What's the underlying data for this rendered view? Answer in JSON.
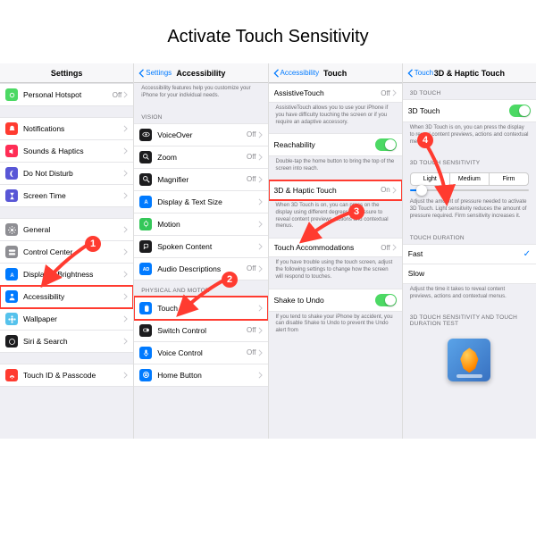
{
  "title": "Activate Touch Sensitivity",
  "panes": {
    "settings": {
      "header": "Settings",
      "groups": [
        [
          {
            "icon": "link",
            "bg": "#4cd964",
            "label": "Personal Hotspot",
            "val": "Off"
          }
        ],
        [
          {
            "icon": "bell",
            "bg": "#ff3b30",
            "label": "Notifications"
          },
          {
            "icon": "sound",
            "bg": "#ff2d55",
            "label": "Sounds & Haptics"
          },
          {
            "icon": "moon",
            "bg": "#5856d6",
            "label": "Do Not Disturb"
          },
          {
            "icon": "hourglass",
            "bg": "#5856d6",
            "label": "Screen Time"
          }
        ],
        [
          {
            "icon": "gear",
            "bg": "#8e8e93",
            "label": "General"
          },
          {
            "icon": "switches",
            "bg": "#8e8e93",
            "label": "Control Center"
          },
          {
            "icon": "aa",
            "bg": "#007aff",
            "label": "Display & Brightness"
          },
          {
            "icon": "person",
            "bg": "#007aff",
            "label": "Accessibility",
            "hl": true
          },
          {
            "icon": "flower",
            "bg": "#55c2ec",
            "label": "Wallpaper"
          },
          {
            "icon": "siri",
            "bg": "#1c1c1e",
            "label": "Siri & Search"
          }
        ],
        [
          {
            "icon": "touchid",
            "bg": "#ff3b30",
            "label": "Touch ID & Passcode"
          }
        ]
      ]
    },
    "accessibility": {
      "back": "Settings",
      "header": "Accessibility",
      "intro": "Accessibility features help you customize your iPhone for your individual needs.",
      "sections": [
        {
          "label": "VISION",
          "rows": [
            {
              "icon": "eye",
              "bg": "#1c1c1e",
              "label": "VoiceOver",
              "val": "Off"
            },
            {
              "icon": "zoom",
              "bg": "#1c1c1e",
              "label": "Zoom",
              "val": "Off"
            },
            {
              "icon": "mag",
              "bg": "#1c1c1e",
              "label": "Magnifier",
              "val": "Off"
            },
            {
              "icon": "aa",
              "bg": "#007aff",
              "label": "Display & Text Size"
            },
            {
              "icon": "motion",
              "bg": "#34c759",
              "label": "Motion"
            },
            {
              "icon": "speak",
              "bg": "#1c1c1e",
              "label": "Spoken Content"
            },
            {
              "icon": "ad",
              "bg": "#007aff",
              "label": "Audio Descriptions",
              "val": "Off"
            }
          ]
        },
        {
          "label": "PHYSICAL AND MOTOR",
          "rows": [
            {
              "icon": "hand",
              "bg": "#007aff",
              "label": "Touch",
              "hl": true
            },
            {
              "icon": "switch",
              "bg": "#1c1c1e",
              "label": "Switch Control",
              "val": "Off"
            },
            {
              "icon": "mic",
              "bg": "#007aff",
              "label": "Voice Control",
              "val": "Off"
            },
            {
              "icon": "home",
              "bg": "#007aff",
              "label": "Home Button"
            }
          ]
        }
      ]
    },
    "touch": {
      "back": "Accessibility",
      "header": "Touch",
      "rows": {
        "assistive": {
          "label": "AssistiveTouch",
          "val": "Off",
          "desc": "AssistiveTouch allows you to use your iPhone if you have difficulty touching the screen or if you require an adaptive accessory."
        },
        "reach": {
          "label": "Reachability",
          "on": true,
          "desc": "Double-tap the home button to bring the top of the screen into reach."
        },
        "haptic": {
          "label": "3D & Haptic Touch",
          "val": "On",
          "desc": "When 3D Touch is on, you can press on the display using different degrees of pressure to reveal content previews, actions and contextual menus."
        },
        "accom": {
          "label": "Touch Accommodations",
          "val": "Off",
          "desc": "If you have trouble using the touch screen, adjust the following settings to change how the screen will respond to touches."
        },
        "shake": {
          "label": "Shake to Undo",
          "on": true,
          "desc": "If you tend to shake your iPhone by accident, you can disable Shake to Undo to prevent the Undo alert from"
        }
      }
    },
    "haptic": {
      "back": "Touch",
      "header": "3D & Haptic Touch",
      "sections": {
        "s3d": {
          "label": "3D TOUCH",
          "row": "3D Touch",
          "on": true,
          "desc": "When 3D Touch is on, you can press the display to reveal content previews, actions and contextual menus."
        },
        "sens": {
          "label": "3D TOUCH SENSITIVITY",
          "opts": [
            "Light",
            "Medium",
            "Firm"
          ],
          "desc": "Adjust the amount of pressure needed to activate 3D Touch. Light sensitivity reduces the amount of pressure required. Firm sensitivity increases it."
        },
        "dur": {
          "label": "TOUCH DURATION",
          "opts": [
            {
              "l": "Fast",
              "check": true
            },
            {
              "l": "Slow"
            }
          ],
          "desc": "Adjust the time it takes to reveal content previews, actions and contextual menus."
        },
        "test": {
          "label": "3D TOUCH SENSITIVITY AND TOUCH DURATION TEST"
        }
      }
    }
  },
  "annotations": [
    "1",
    "2",
    "3",
    "4"
  ]
}
